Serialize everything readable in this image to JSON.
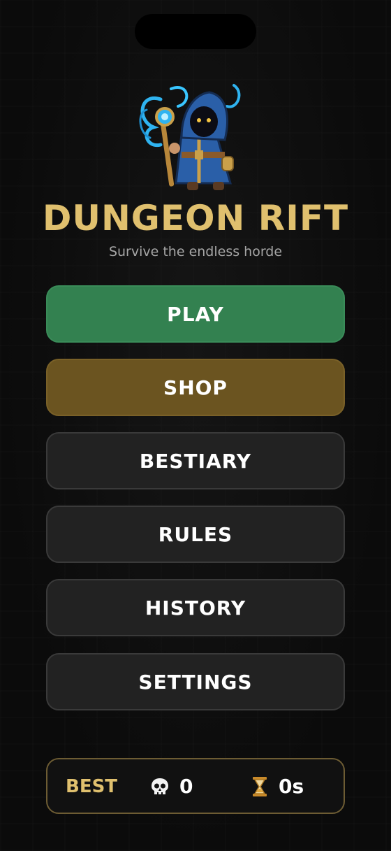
{
  "game": {
    "title": "DUNGEON RIFT",
    "subtitle": "Survive the endless horde",
    "hero_icon": "hooded-wizard-with-staff"
  },
  "menu": {
    "play": "PLAY",
    "shop": "SHOP",
    "bestiary": "BESTIARY",
    "rules": "RULES",
    "history": "HISTORY",
    "settings": "SETTINGS"
  },
  "best": {
    "label": "BEST",
    "kills_icon": "skull-icon",
    "kills": "0",
    "time_icon": "hourglass-icon",
    "time": "0s"
  },
  "colors": {
    "title_gold": "#e0c06e",
    "play_green": "#338150",
    "shop_brown": "#6b5420",
    "button_dark": "#222222",
    "background": "#0b0b0b"
  }
}
